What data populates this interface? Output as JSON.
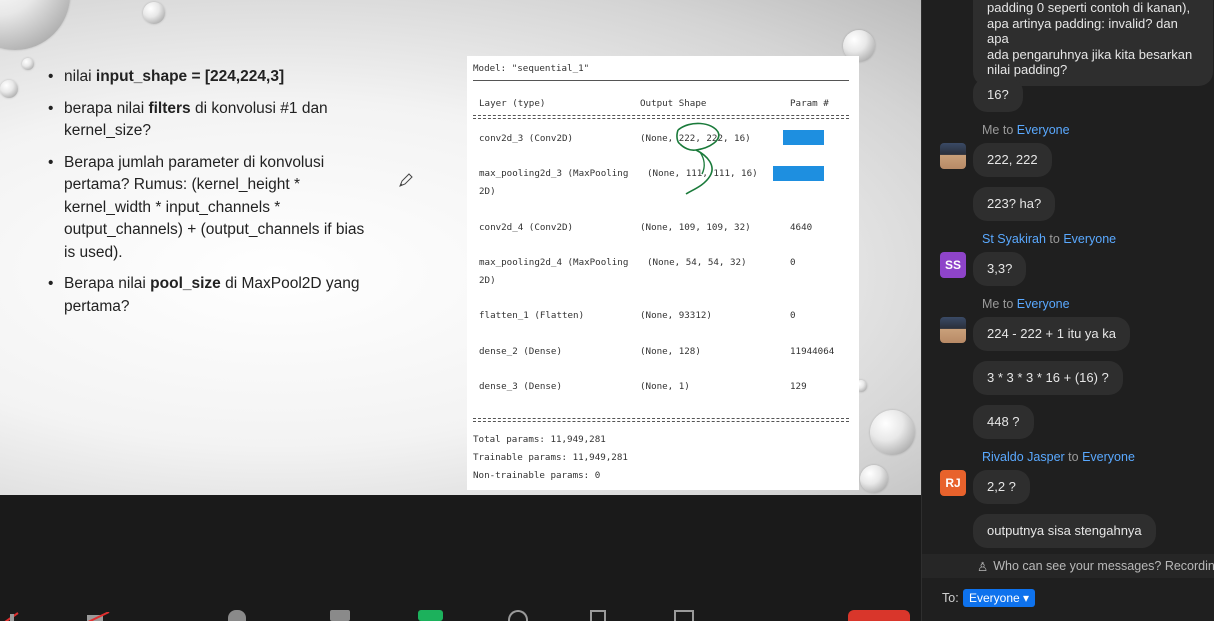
{
  "slide": {
    "bullets": [
      {
        "pre": "nilai ",
        "bold": "input_shape = [224,224,3]",
        "post": ""
      },
      {
        "pre": "berapa nilai ",
        "bold": "filters",
        "post": " di konvolusi #1 dan kernel_size?"
      },
      {
        "pre": "Berapa jumlah parameter di konvolusi pertama? Rumus: (kernel_height * kernel_width * input_channels * output_channels) + (output_channels if bias is used).",
        "bold": "",
        "post": ""
      },
      {
        "pre": "Berapa nilai ",
        "bold": "pool_size",
        "post": " di MaxPool2D yang pertama?"
      }
    ],
    "model": {
      "title": "Model: \"sequential_1\"",
      "headers": [
        "Layer (type)",
        "Output Shape",
        "Param #"
      ],
      "rows": [
        {
          "layer": "conv2d_3 (Conv2D)",
          "layer2": "",
          "shape": "(None, 222, 222, 16)",
          "param": ""
        },
        {
          "layer": "max_pooling2d_3 (MaxPooling",
          "layer2": "2D)",
          "shape": "(None, 111, 111, 16)",
          "param": ""
        },
        {
          "layer": "conv2d_4 (Conv2D)",
          "layer2": "",
          "shape": "(None, 109, 109, 32)",
          "param": "4640"
        },
        {
          "layer": "max_pooling2d_4 (MaxPooling",
          "layer2": "2D)",
          "shape": "(None, 54, 54, 32)",
          "param": "0"
        },
        {
          "layer": "flatten_1 (Flatten)",
          "layer2": "",
          "shape": "(None, 93312)",
          "param": "0"
        },
        {
          "layer": "dense_2 (Dense)",
          "layer2": "",
          "shape": "(None, 128)",
          "param": "11944064"
        },
        {
          "layer": "dense_3 (Dense)",
          "layer2": "",
          "shape": "(None, 1)",
          "param": "129"
        }
      ],
      "total": "Total params: 11,949,281",
      "trainable": "Trainable params: 11,949,281",
      "non_trainable": "Non-trainable params: 0",
      "highlight_color": "#1e8fe0"
    }
  },
  "chat": {
    "top_message": "padding 0 seperti contoh di kanan), apa artinya padding: invalid? dan apa ada pengaruhnya jika kita besarkan nilai padding?",
    "top_message_lines": [
      "padding 0 seperti contoh di kanan),",
      "apa artinya padding: invalid? dan apa",
      "ada pengaruhnya jika kita besarkan",
      "nilai padding?"
    ],
    "messages": [
      {
        "kind": "bubble",
        "text": "16?"
      },
      {
        "kind": "sender",
        "name": "Me",
        "to_word": "to",
        "target": "Everyone"
      },
      {
        "kind": "bubble",
        "text": "222, 222",
        "avatar": "photo"
      },
      {
        "kind": "bubble",
        "text": "223? ha?"
      },
      {
        "kind": "sender",
        "name": "St Syakirah",
        "to_word": "to",
        "target": "Everyone"
      },
      {
        "kind": "bubble",
        "text": "3,3?",
        "avatar": "SS"
      },
      {
        "kind": "sender",
        "name": "Me",
        "to_word": "to",
        "target": "Everyone"
      },
      {
        "kind": "bubble",
        "text": "224 - 222 + 1 itu ya ka",
        "avatar": "photo"
      },
      {
        "kind": "bubble",
        "text": "3 * 3 * 3 * 16 + (16) ?"
      },
      {
        "kind": "bubble",
        "text": "448 ?"
      },
      {
        "kind": "sender",
        "name": "Rivaldo Jasper",
        "to_word": "to",
        "target": "Everyone"
      },
      {
        "kind": "bubble",
        "text": "2,2 ?",
        "avatar": "RJ"
      },
      {
        "kind": "bubble",
        "text": "outputnya sisa stengahnya"
      }
    ],
    "avatars": {
      "SS": {
        "initials": "SS",
        "color": "#8e44c9"
      },
      "RJ": {
        "initials": "RJ",
        "color": "#e8622c"
      }
    },
    "footer_note": "Who can see your messages? Recording",
    "to_label": "To:",
    "to_value": "Everyone",
    "name_color": "#5aa9ff"
  }
}
